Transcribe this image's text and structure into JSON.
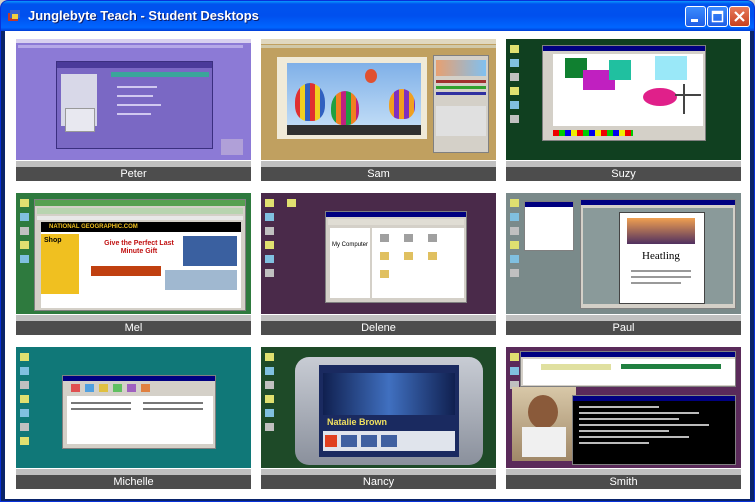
{
  "window": {
    "title": "Junglebyte Teach - Student Desktops"
  },
  "colors": {
    "titlebar": "#0054e3",
    "label_bg": "#4d4d4d",
    "label_text": "#ffffff"
  },
  "students": [
    {
      "name": "Peter"
    },
    {
      "name": "Sam"
    },
    {
      "name": "Suzy"
    },
    {
      "name": "Mel"
    },
    {
      "name": "Delene"
    },
    {
      "name": "Paul"
    },
    {
      "name": "Michelle"
    },
    {
      "name": "Nancy"
    },
    {
      "name": "Smith"
    }
  ],
  "thumbnails": {
    "mel_banner": "NATIONAL GEOGRAPHIC.COM",
    "mel_headline": "Give the Perfect Last Minute Gift",
    "mel_shop": "Shop",
    "delene_label": "My Computer",
    "paul_doc": "Heatling",
    "nancy_name": "Natalie Brown"
  }
}
